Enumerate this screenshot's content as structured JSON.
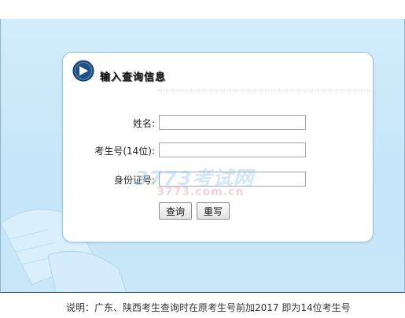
{
  "panel": {
    "title": "输入查询信息",
    "title_icon": "circle-arrow-right-icon"
  },
  "form": {
    "name_label": "姓名:",
    "name_value": "",
    "exam_no_label": "考生号(14位):",
    "exam_no_value": "",
    "id_label": "身份证号:",
    "id_value": "",
    "query_button": "查询",
    "reset_button": "重写"
  },
  "watermark": {
    "brand": "3773考试网",
    "url": "3773.com.cn"
  },
  "footer": {
    "note": "说明：广东、陕西考生查询时在原考生号前加2017 即为14位考生号"
  },
  "colors": {
    "background_blue": "#c6e6f9",
    "panel_border": "#9fc6df",
    "icon_blue": "#1f4f86"
  }
}
